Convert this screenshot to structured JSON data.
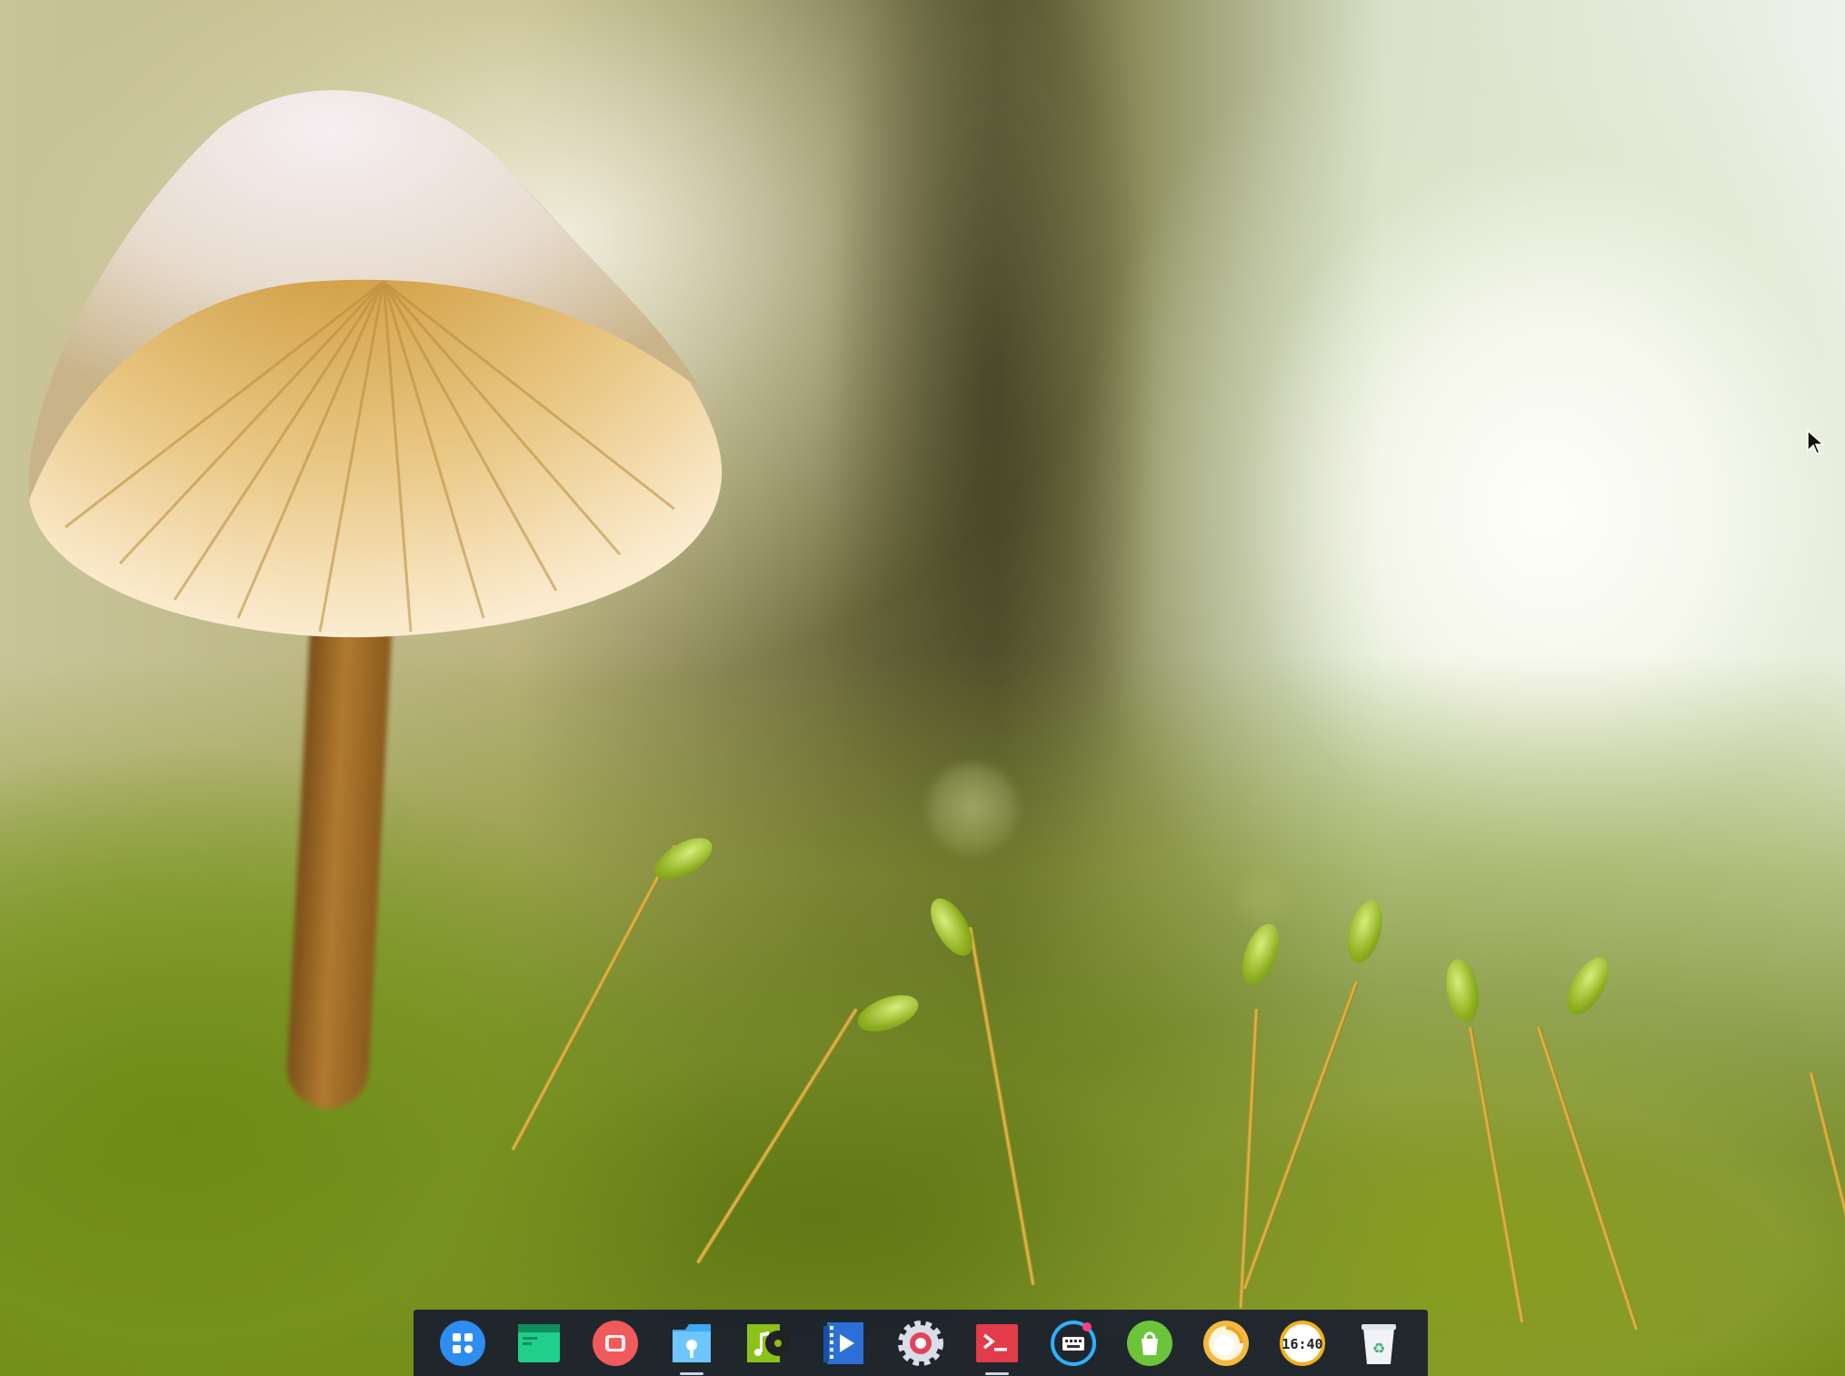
{
  "desktop": {
    "wallpaper": "mushroom-moss-wallpaper"
  },
  "dock": {
    "items": [
      {
        "name": "launcher",
        "icon": "launcher-grid-icon",
        "running": false,
        "color": "#2f8cf0"
      },
      {
        "name": "system-monitor",
        "icon": "monitor-icon",
        "running": false,
        "color": "#1fcf8a"
      },
      {
        "name": "screen-recorder",
        "icon": "record-icon",
        "running": false,
        "color": "#f05a5a"
      },
      {
        "name": "file-manager",
        "icon": "folder-icon",
        "running": true,
        "color": "#3fa9f5"
      },
      {
        "name": "music",
        "icon": "music-icon",
        "running": false,
        "color": "#8bc21a"
      },
      {
        "name": "video",
        "icon": "video-icon",
        "running": false,
        "color": "#2d6fd8"
      },
      {
        "name": "settings",
        "icon": "gear-icon",
        "running": false,
        "color": "#d8dde8"
      },
      {
        "name": "terminal",
        "icon": "terminal-icon",
        "running": true,
        "color": "#e23b4a"
      },
      {
        "name": "input-method",
        "icon": "keyboard-icon",
        "running": false,
        "color": "#2fb0ff"
      },
      {
        "name": "app-store",
        "icon": "store-bag-icon",
        "running": false,
        "color": "#6cc43a"
      },
      {
        "name": "browser",
        "icon": "browser-icon",
        "running": false,
        "color": "#f5b940"
      },
      {
        "name": "clock",
        "icon": "clock-icon",
        "running": false,
        "color": "#f2b020",
        "clock_text": "16:40"
      },
      {
        "name": "trash",
        "icon": "trash-icon",
        "running": false,
        "color": "#f0f2f5"
      }
    ]
  }
}
